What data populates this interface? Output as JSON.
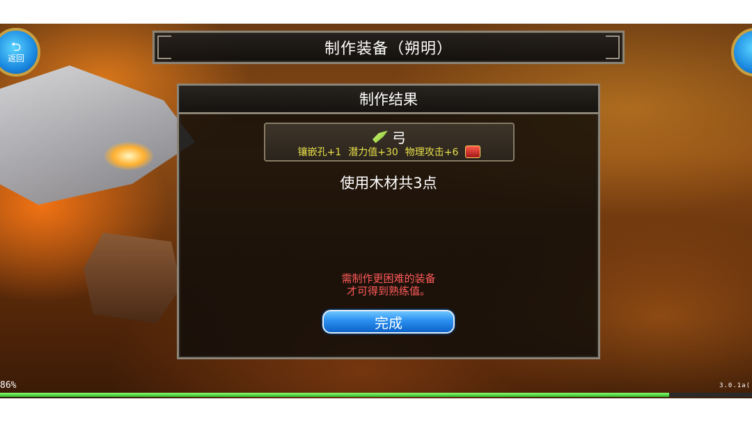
{
  "title": "制作装备（朔明）",
  "back_button": {
    "icon": "return-arrow-icon",
    "label": "返回"
  },
  "right_orb": {
    "icon": "orb-icon"
  },
  "result_panel": {
    "header": "制作结果",
    "item": {
      "icon": "bow-icon",
      "name": "弓",
      "stats": [
        "镶嵌孔+1",
        "潜力值+30",
        "物理攻击+6"
      ],
      "badge_icon": "treasure-chest-icon"
    },
    "material_text": "使用木材共3点",
    "hint_lines": [
      "需制作更困难的装备",
      "才可得到熟练值。"
    ],
    "done_label": "完成"
  },
  "status": {
    "progress_text": "86%",
    "progress_value": 0.89,
    "version": "3.0.1a("
  },
  "colors": {
    "hint": "#ff5a5a",
    "stats": "#e8e04a",
    "button": "#2a8ff0",
    "progress": "#2fb52f"
  }
}
